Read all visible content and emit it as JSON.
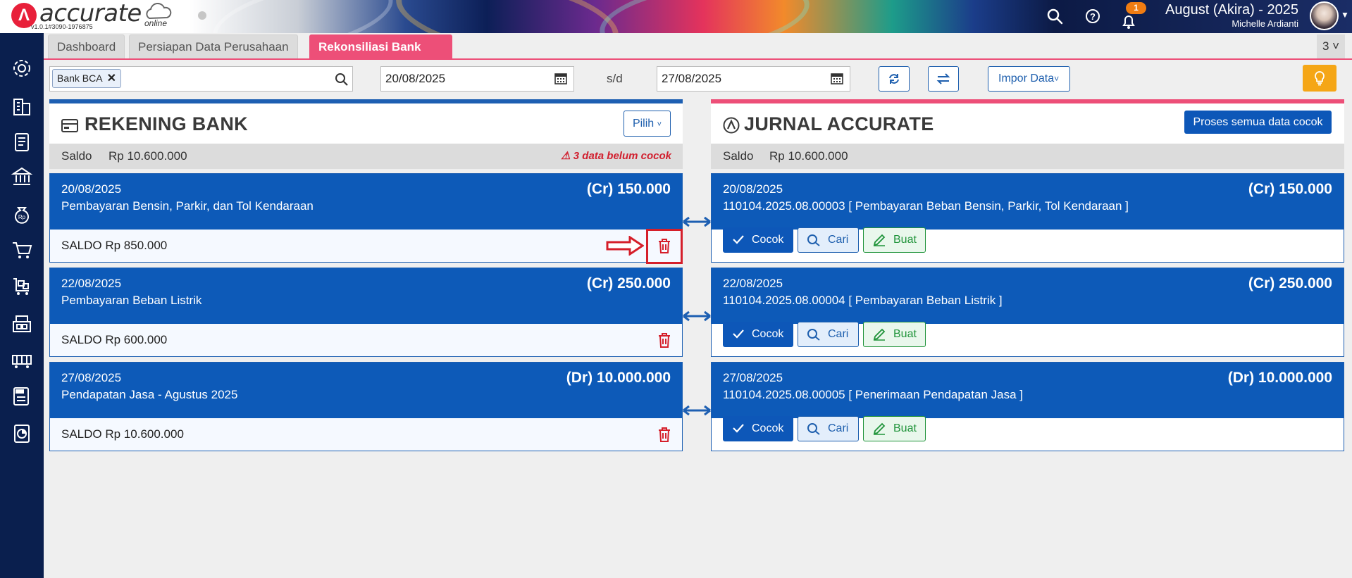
{
  "app": {
    "logo_text": "accurate",
    "logo_sub": "online",
    "version": "v1.0.1#3090-1976875"
  },
  "header": {
    "notification_count": "1",
    "company": "August (Akira) - 2025",
    "user": "Michelle Ardianti"
  },
  "sidebar": {
    "icons": [
      "gear-icon",
      "building-icon",
      "ledger-icon",
      "bank-icon",
      "money-bag-icon",
      "cart-icon",
      "delivery-cart-icon",
      "warehouse-icon",
      "factory-icon",
      "tax-icon",
      "report-icon"
    ]
  },
  "tabs": [
    {
      "label": "Dashboard",
      "active": false
    },
    {
      "label": "Persiapan Data Perusahaan",
      "active": false
    },
    {
      "label": "Rekonsiliasi Bank",
      "active": true
    }
  ],
  "tab_overflow": "3",
  "filters": {
    "bank_chip": "Bank BCA",
    "date_from": "20/08/2025",
    "separator": "s/d",
    "date_to": "27/08/2025",
    "import_label": "Impor Data"
  },
  "bank_panel": {
    "title": "REKENING BANK",
    "pilih_label": "Pilih",
    "saldo_label": "Saldo",
    "saldo_value": "Rp 10.600.000",
    "warning": "3 data belum cocok",
    "items": [
      {
        "date": "20/08/2025",
        "description": "Pembayaran Bensin, Parkir, dan Tol Kendaraan",
        "amount": "(Cr) 150.000",
        "saldo": "SALDO Rp 850.000"
      },
      {
        "date": "22/08/2025",
        "description": "Pembayaran Beban Listrik",
        "amount": "(Cr) 250.000",
        "saldo": "SALDO Rp 600.000"
      },
      {
        "date": "27/08/2025",
        "description": "Pendapatan Jasa - Agustus 2025",
        "amount": "(Dr) 10.000.000",
        "saldo": "SALDO Rp 10.600.000"
      }
    ]
  },
  "journal_panel": {
    "title": "JURNAL ACCURATE",
    "process_label": "Proses semua data cocok",
    "saldo_label": "Saldo",
    "saldo_value": "Rp 10.600.000",
    "items": [
      {
        "date": "20/08/2025",
        "description": "110104.2025.08.00003 [ Pembayaran Beban Bensin, Parkir, Tol Kendaraan ]",
        "amount": "(Cr) 150.000"
      },
      {
        "date": "22/08/2025",
        "description": "110104.2025.08.00004 [ Pembayaran Beban Listrik ]",
        "amount": "(Cr) 250.000"
      },
      {
        "date": "27/08/2025",
        "description": "110104.2025.08.00005 [ Penerimaan Pendapatan Jasa ]",
        "amount": "(Dr) 10.000.000"
      }
    ],
    "actions": {
      "match": "Cocok",
      "search": "Cari",
      "create": "Buat"
    }
  },
  "colors": {
    "navy": "#0a1f4e",
    "primary": "#0d5ab8",
    "pink": "#ed4f78",
    "danger": "#d51f2a",
    "success": "#20943a",
    "warning": "#f5a616"
  }
}
